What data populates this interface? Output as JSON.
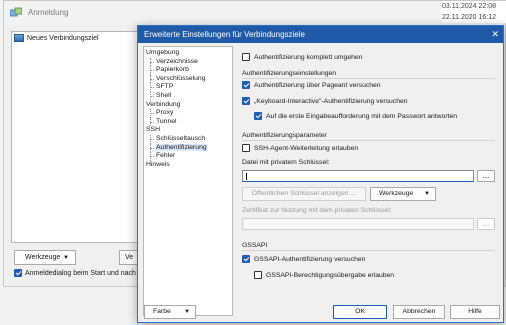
{
  "background_window": {
    "title": "Anmeldung",
    "dates": [
      "03.11.2024 22:08",
      "22.11.2020 16:12"
    ],
    "site_list": {
      "item": "Neues Verbindungsziel"
    },
    "tools_button": "Werkzeuge",
    "version_button_partial": "Ve",
    "startup_checkbox": {
      "label": "Anmeldedialog beim Start und nach Sch",
      "checked": true
    }
  },
  "dialog": {
    "title": "Erweiterte Einstellungen für Verbindungsziele",
    "window_buttons": {
      "minimize": "—",
      "close": "✕"
    },
    "tree": [
      {
        "label": "Umgebung",
        "level": 0
      },
      {
        "label": "Verzeichnisse",
        "level": 1
      },
      {
        "label": "Papierkorb",
        "level": 1
      },
      {
        "label": "Verschlüsselung",
        "level": 1
      },
      {
        "label": "SFTP",
        "level": 1
      },
      {
        "label": "Shell",
        "level": 1
      },
      {
        "label": "Verbindung",
        "level": 0
      },
      {
        "label": "Proxy",
        "level": 1
      },
      {
        "label": "Tunnel",
        "level": 1
      },
      {
        "label": "SSH",
        "level": 0
      },
      {
        "label": "Schlüsseltausch",
        "level": 1
      },
      {
        "label": "Authentifizierung",
        "level": 1,
        "selected": true
      },
      {
        "label": "Fehler",
        "level": 1
      },
      {
        "label": "Hinweis",
        "level": 0
      }
    ],
    "bypass_auth": {
      "label": "Authentifizierung komplett umgehen",
      "checked": false
    },
    "auth_settings": {
      "title": "Authentifizierungseinstellungen",
      "pageant": {
        "label": "Authentifizierung über Pageant versuchen",
        "checked": true
      },
      "keyboard_interactive": {
        "label": "„Keyboard-Interactive\"-Authentifizierung versuchen",
        "checked": true
      },
      "password_first": {
        "label": "Auf die erste Eingabeaufforderung mit dem Passwort antworten",
        "checked": true
      }
    },
    "auth_params": {
      "title": "Authentifizierungsparameter",
      "agent_forwarding": {
        "label": "SSH-Agent-Weiterleitung erlauben",
        "checked": false
      },
      "private_key_label": "Datei mit privatem Schlüssel:",
      "private_key_value": "",
      "browse_button": "...",
      "show_public_key_button": "Öffentlichen Schlüssel anzeigen ...",
      "tools_button": "Werkzeuge",
      "certificate_label": "Zertifikat zur Nutzung mit dem privaten Schlüssel:",
      "certificate_browse": "..."
    },
    "gssapi": {
      "title": "GSSAPI",
      "auth": {
        "label": "GSSAPI-Authentifizierung versuchen",
        "checked": true
      },
      "delegation": {
        "label": "GSSAPI-Berechtigungsübergabe erlauben",
        "checked": false
      }
    },
    "footer": {
      "color_button": "Farbe",
      "ok_button": "OK",
      "cancel_button": "Abbrechen",
      "help_button": "Hilfe"
    }
  }
}
